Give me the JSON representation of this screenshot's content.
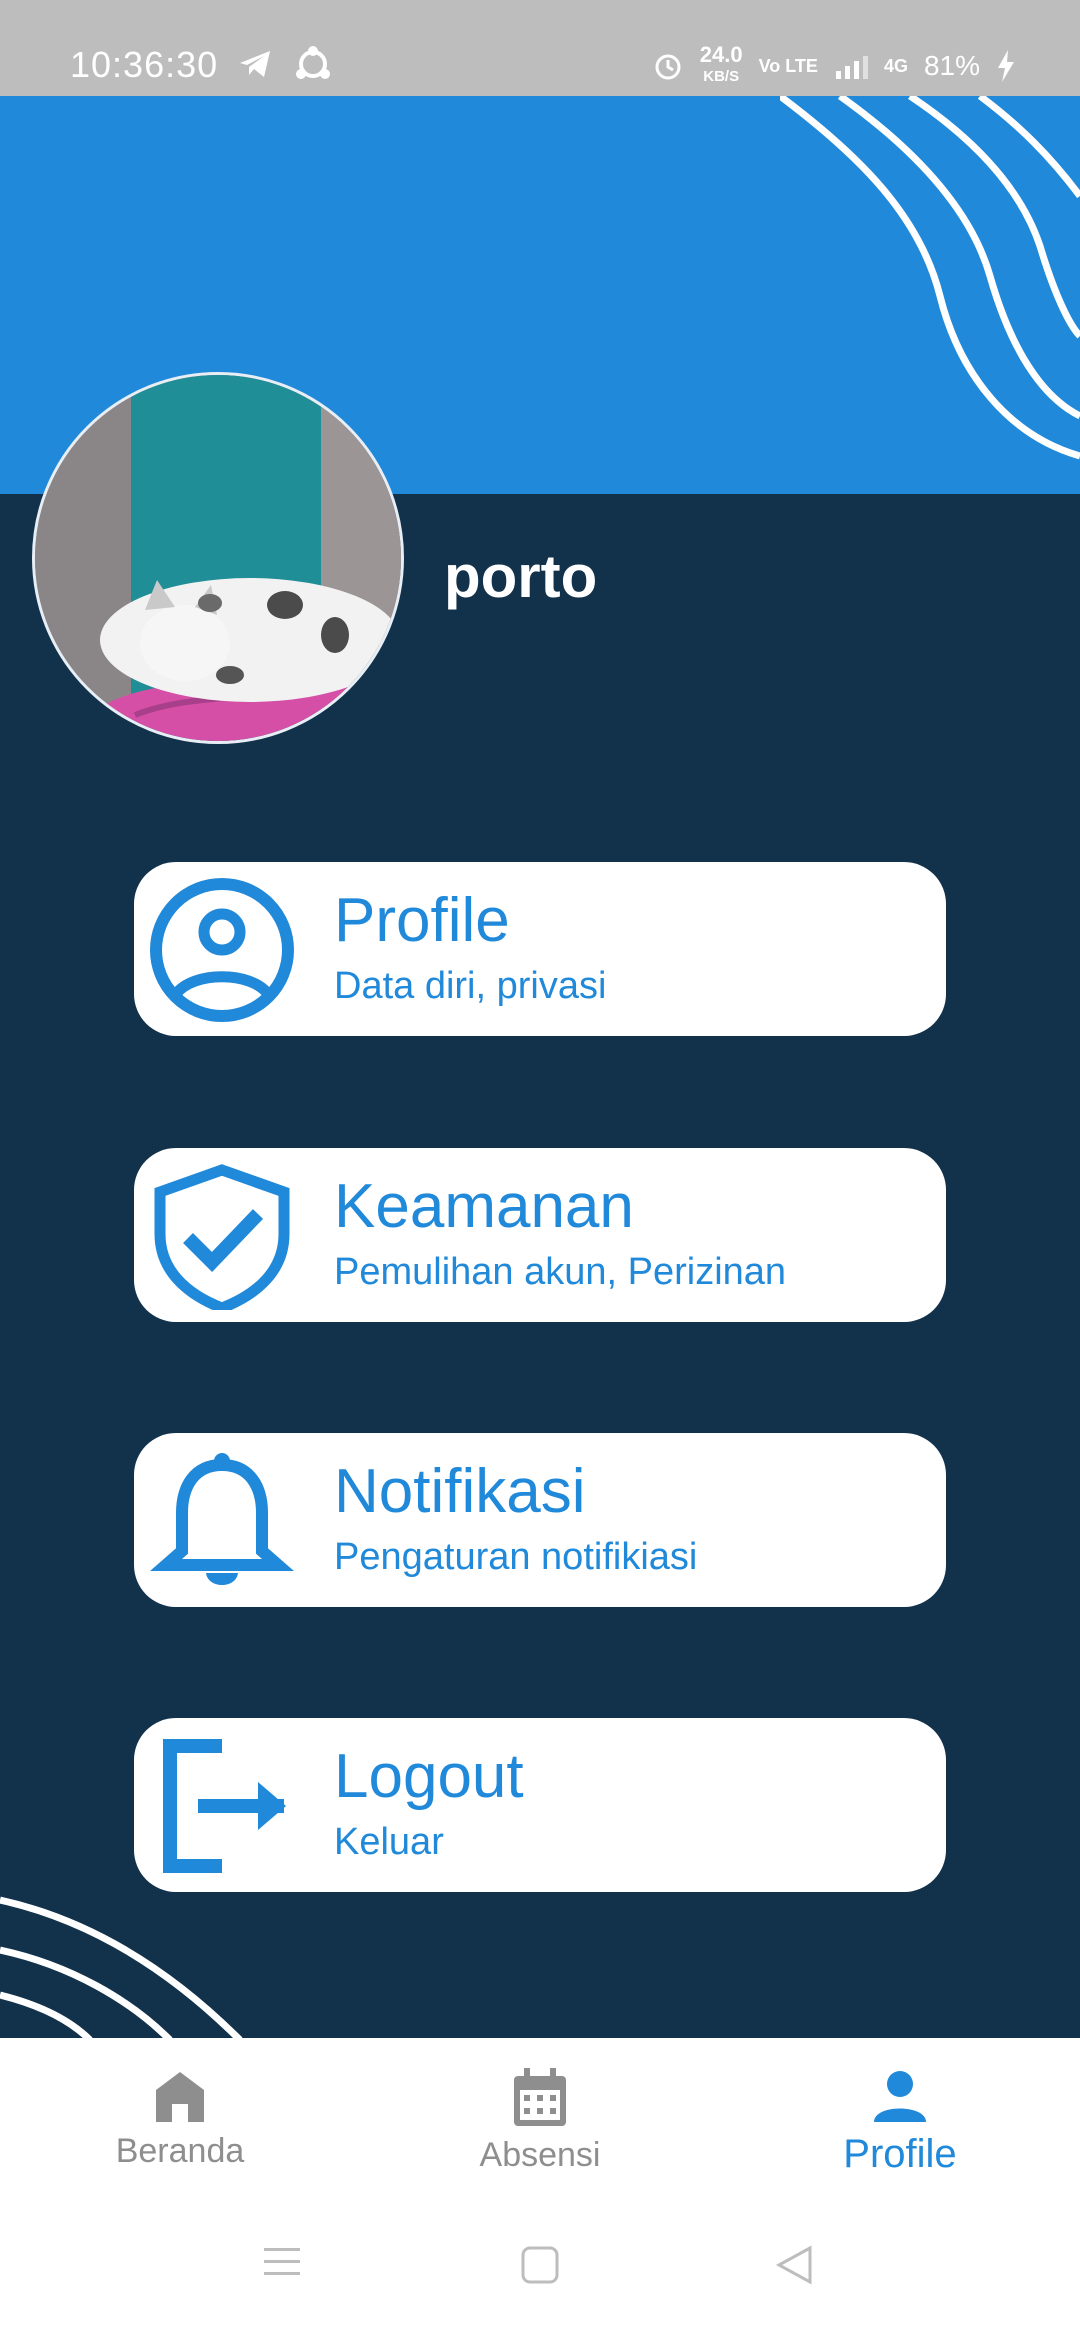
{
  "status_bar": {
    "time": "10:36:30",
    "speed_value": "24.0",
    "speed_unit": "KB/S",
    "volte": "Vo LTE",
    "network": "4G",
    "battery": "81%"
  },
  "profile": {
    "username": "porto"
  },
  "menu": [
    {
      "title": "Profile",
      "subtitle": "Data diri, privasi",
      "icon": "account-circle-icon"
    },
    {
      "title": "Keamanan",
      "subtitle": "Pemulihan akun, Perizinan",
      "icon": "shield-check-icon"
    },
    {
      "title": "Notifikasi",
      "subtitle": "Pengaturan notifikiasi",
      "icon": "bell-icon"
    },
    {
      "title": "Logout",
      "subtitle": "Keluar",
      "icon": "logout-icon"
    }
  ],
  "bottom_nav": [
    {
      "label": "Beranda",
      "icon": "home-icon",
      "active": false
    },
    {
      "label": "Absensi",
      "icon": "calendar-icon",
      "active": false
    },
    {
      "label": "Profile",
      "icon": "person-icon",
      "active": true
    }
  ],
  "colors": {
    "primary_blue": "#2189da",
    "dark_navy": "#12314b",
    "status_gray": "#bdbdbd",
    "inactive_gray": "#8e8e8e"
  }
}
